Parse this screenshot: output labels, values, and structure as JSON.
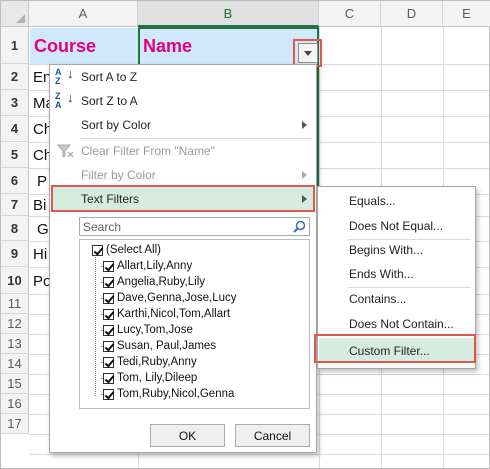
{
  "sheet": {
    "columns": [
      "A",
      "B",
      "C",
      "D",
      "E"
    ],
    "rows": [
      "1",
      "2",
      "3",
      "4",
      "5",
      "6",
      "7",
      "8",
      "9",
      "10",
      "11",
      "12",
      "13",
      "14",
      "15",
      "16",
      "17"
    ],
    "header_course": "Course",
    "header_name": "Name",
    "colA_values": [
      "En",
      "Ma",
      "Ch",
      "Ch",
      "P",
      "Bi",
      "G",
      "Hi",
      "Po"
    ]
  },
  "menu": {
    "sort_a_z": "Sort A to Z",
    "sort_z_a": "Sort Z to A",
    "sort_by_color": "Sort by Color",
    "clear_filter": "Clear Filter From \"Name\"",
    "filter_by_color": "Filter by Color",
    "text_filters": "Text Filters",
    "search_placeholder": "Search",
    "items": [
      "(Select All)",
      "Allart,Lily,Anny",
      "Angelia,Ruby,Lily",
      "Dave,Genna,Jose,Lucy",
      "Karthi,Nicol,Tom,Allart",
      "Lucy,Tom,Jose",
      "Susan, Paul,James",
      "Tedi,Ruby,Anny",
      "Tom, Lily,Dileep",
      "Tom,Ruby,Nicol,Genna"
    ],
    "ok": "OK",
    "cancel": "Cancel"
  },
  "submenu": {
    "equals": "Equals...",
    "does_not_equal": "Does Not Equal...",
    "begins_with": "Begins With...",
    "ends_with": "Ends With...",
    "contains": "Contains...",
    "does_not_contain": "Does Not Contain...",
    "custom_filter": "Custom Filter..."
  },
  "colors": {
    "header_fill": "#cfe8fb",
    "header_text": "#e6007e",
    "selection_green": "#217346",
    "highlight_red": "#e2574c",
    "menu_active": "#d6ebdf"
  }
}
